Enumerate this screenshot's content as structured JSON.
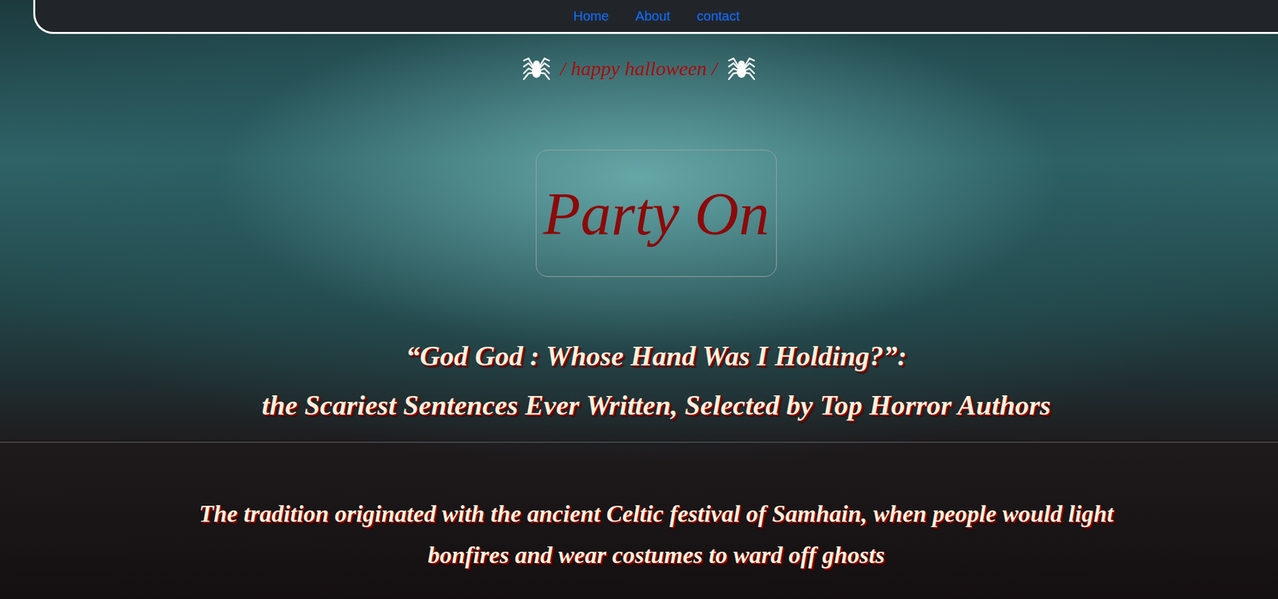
{
  "nav": {
    "items": [
      {
        "label": "Home"
      },
      {
        "label": "About"
      },
      {
        "label": "contact"
      }
    ]
  },
  "banner": {
    "text": "/ happy halloween /"
  },
  "feature_box": {
    "text": "Party On"
  },
  "headline": {
    "lines": [
      "“God God : Whose Hand Was I Holding?”:",
      "the Scariest Sentences Ever Written, Selected by Top Horror Authors"
    ]
  },
  "paragraph": {
    "lines": [
      "The tradition originated with the ancient Celtic festival of Samhain, when people would light",
      "bonfires and wear costumes to ward off ghosts"
    ]
  }
}
